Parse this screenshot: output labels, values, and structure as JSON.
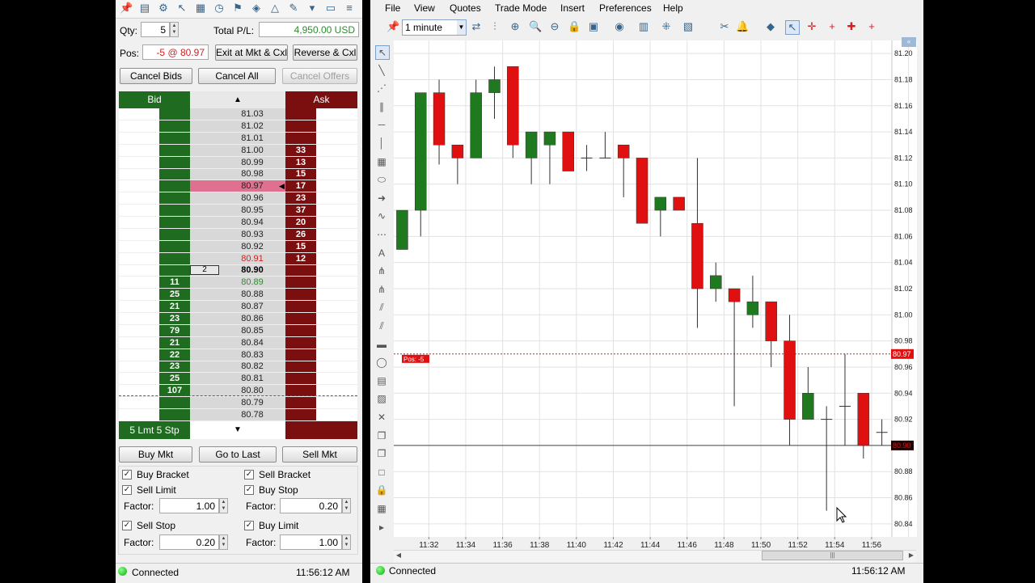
{
  "dom": {
    "toolbar_icons": [
      "pushpin-icon",
      "calendar-icon",
      "gear-icon",
      "cursor-icon",
      "clipboard-icon",
      "clock-icon",
      "pin-icon",
      "shield-icon",
      "draw-icon",
      "paint-icon",
      "chevron-down-icon",
      "window-icon",
      "menu-icon"
    ],
    "qty": {
      "label": "Qty:",
      "value": "5"
    },
    "pnl": {
      "label": "Total P/L:",
      "value": "4,950.00 USD"
    },
    "pos": {
      "label": "Pos:",
      "value": "-5 @ 80.97"
    },
    "buttons": {
      "exit": "Exit at Mkt & Cxl",
      "reverse": "Reverse & Cxl",
      "cancel_bids": "Cancel Bids",
      "cancel_all": "Cancel All",
      "cancel_offers": "Cancel Offers",
      "buy_mkt": "Buy Mkt",
      "go_to_last": "Go to Last",
      "sell_mkt": "Sell Mkt"
    },
    "ladder": {
      "bid_header": "Bid",
      "ask_header": "Ask",
      "footer": "5 Lmt 5 Stp",
      "working_order_qty": "2",
      "rows": [
        {
          "price": "81.03",
          "bid": "",
          "ask": ""
        },
        {
          "price": "81.02",
          "bid": "",
          "ask": ""
        },
        {
          "price": "81.01",
          "bid": "",
          "ask": ""
        },
        {
          "price": "81.00",
          "bid": "",
          "ask": "33"
        },
        {
          "price": "80.99",
          "bid": "",
          "ask": "13"
        },
        {
          "price": "80.98",
          "bid": "",
          "ask": "15"
        },
        {
          "price": "80.97",
          "bid": "",
          "ask": "17"
        },
        {
          "price": "80.96",
          "bid": "",
          "ask": "23"
        },
        {
          "price": "80.95",
          "bid": "",
          "ask": "37"
        },
        {
          "price": "80.94",
          "bid": "",
          "ask": "20"
        },
        {
          "price": "80.93",
          "bid": "",
          "ask": "26"
        },
        {
          "price": "80.92",
          "bid": "",
          "ask": "15"
        },
        {
          "price": "80.91",
          "bid": "",
          "ask": "12"
        },
        {
          "price": "80.90",
          "bid": "",
          "ask": ""
        },
        {
          "price": "80.89",
          "bid": "11",
          "ask": ""
        },
        {
          "price": "80.88",
          "bid": "25",
          "ask": ""
        },
        {
          "price": "80.87",
          "bid": "21",
          "ask": ""
        },
        {
          "price": "80.86",
          "bid": "23",
          "ask": ""
        },
        {
          "price": "80.85",
          "bid": "79",
          "ask": ""
        },
        {
          "price": "80.84",
          "bid": "21",
          "ask": ""
        },
        {
          "price": "80.83",
          "bid": "22",
          "ask": ""
        },
        {
          "price": "80.82",
          "bid": "23",
          "ask": ""
        },
        {
          "price": "80.81",
          "bid": "25",
          "ask": ""
        },
        {
          "price": "80.80",
          "bid": "107",
          "ask": ""
        },
        {
          "price": "80.79",
          "bid": "",
          "ask": ""
        },
        {
          "price": "80.78",
          "bid": "",
          "ask": ""
        }
      ]
    },
    "bracket": {
      "buy_bracket": "Buy Bracket",
      "sell_limit": "Sell Limit",
      "sell_bracket": "Sell Bracket",
      "buy_stop": "Buy Stop",
      "sell_stop": "Sell Stop",
      "buy_limit": "Buy Limit",
      "factor_label": "Factor:",
      "factor_left_top": "1.00",
      "factor_right_top": "0.20",
      "factor_left_bottom": "0.20",
      "factor_right_bottom": "1.00"
    },
    "status_left": {
      "text": "Connected",
      "time": "11:56:12 AM"
    },
    "status_right": {
      "text": "Connected",
      "time": "11:56:12 AM"
    },
    "menu": [
      "File",
      "View",
      "Quotes",
      "Trade Mode",
      "Insert",
      "Preferences",
      "Help"
    ],
    "interval": "1 minute",
    "chart_toolbar_icons": [
      "pushpin-icon",
      "interval-dropdown",
      "arrows-icon",
      "bar-type-icon",
      "zoom-in-icon",
      "zoom-in-icon-2",
      "zoom-out-icon",
      "lock-icon",
      "picture-icon",
      "paint-icon",
      "chart-type-icon",
      "grid-icon",
      "color-icon",
      "scissors-icon",
      "bell-icon",
      "eraser-icon",
      "cursor-icon",
      "crosshair-icon",
      "cross-icon",
      "target-icon",
      "plus-icon"
    ],
    "left_tools": [
      "select-arrow-icon",
      "line-icon",
      "ray-icon",
      "parallel-icon",
      "hline-icon",
      "vline-icon",
      "clipboard-icon",
      "ellipse-icon",
      "arrow-icon",
      "wave-icon",
      "dots-icon",
      "text-icon",
      "pitchfork-icon",
      "fork-icon",
      "channel-icon",
      "channel2-icon",
      "rectangle-icon",
      "circle-icon",
      "stack-icon",
      "image-icon",
      "delete-icon",
      "copy-icon",
      "copy2-icon",
      "square-icon",
      "lock-icon",
      "grid-icon",
      "expand-icon"
    ]
  },
  "chart_data": {
    "type": "candlestick",
    "position_label": "Pos: -5",
    "position_price_label": "80.97",
    "last_price_label": "80.90",
    "y_ticks": [
      "81.20",
      "81.18",
      "81.16",
      "81.14",
      "81.12",
      "81.10",
      "81.08",
      "81.06",
      "81.04",
      "81.02",
      "81.00",
      "80.98",
      "80.96",
      "80.94",
      "80.92",
      "80.90",
      "80.88",
      "80.86",
      "80.84"
    ],
    "x_ticks": [
      "11:32",
      "11:34",
      "11:36",
      "11:38",
      "11:40",
      "11:42",
      "11:44",
      "11:46",
      "11:48",
      "11:50",
      "11:52",
      "11:54",
      "11:56"
    ],
    "ylim": [
      80.83,
      81.21
    ],
    "candles": [
      {
        "o": 81.05,
        "h": 81.08,
        "l": 81.05,
        "c": 81.08
      },
      {
        "o": 81.08,
        "h": 81.09,
        "l": 81.06,
        "c": 81.17
      },
      {
        "o": 81.17,
        "h": 81.18,
        "l": 81.115,
        "c": 81.13
      },
      {
        "o": 81.13,
        "h": 81.13,
        "l": 81.1,
        "c": 81.12
      },
      {
        "o": 81.12,
        "h": 81.18,
        "l": 81.12,
        "c": 81.17
      },
      {
        "o": 81.17,
        "h": 81.19,
        "l": 81.15,
        "c": 81.18
      },
      {
        "o": 81.19,
        "h": 81.19,
        "l": 81.12,
        "c": 81.13
      },
      {
        "o": 81.12,
        "h": 81.14,
        "l": 81.1,
        "c": 81.14
      },
      {
        "o": 81.13,
        "h": 81.14,
        "l": 81.1,
        "c": 81.14
      },
      {
        "o": 81.14,
        "h": 81.14,
        "l": 81.11,
        "c": 81.11
      },
      {
        "o": 81.12,
        "h": 81.13,
        "l": 81.11,
        "c": 81.12
      },
      {
        "o": 81.12,
        "h": 81.14,
        "l": 81.12,
        "c": 81.12
      },
      {
        "o": 81.13,
        "h": 81.13,
        "l": 81.09,
        "c": 81.12
      },
      {
        "o": 81.12,
        "h": 81.12,
        "l": 81.07,
        "c": 81.07
      },
      {
        "o": 81.08,
        "h": 81.09,
        "l": 81.06,
        "c": 81.09
      },
      {
        "o": 81.09,
        "h": 81.09,
        "l": 81.08,
        "c": 81.08
      },
      {
        "o": 81.07,
        "h": 81.12,
        "l": 80.99,
        "c": 81.02
      },
      {
        "o": 81.02,
        "h": 81.04,
        "l": 81.01,
        "c": 81.03
      },
      {
        "o": 81.02,
        "h": 81.02,
        "l": 80.93,
        "c": 81.01
      },
      {
        "o": 81.0,
        "h": 81.03,
        "l": 80.99,
        "c": 81.01
      },
      {
        "o": 81.01,
        "h": 81.01,
        "l": 80.96,
        "c": 80.98
      },
      {
        "o": 80.98,
        "h": 81.0,
        "l": 80.9,
        "c": 80.92
      },
      {
        "o": 80.92,
        "h": 80.96,
        "l": 80.92,
        "c": 80.94
      },
      {
        "o": 80.92,
        "h": 80.93,
        "l": 80.85,
        "c": 80.92
      },
      {
        "o": 80.93,
        "h": 80.97,
        "l": 80.9,
        "c": 80.93
      },
      {
        "o": 80.94,
        "h": 80.94,
        "l": 80.89,
        "c": 80.9
      },
      {
        "o": 80.91,
        "h": 80.92,
        "l": 80.9,
        "c": 80.91
      }
    ]
  }
}
